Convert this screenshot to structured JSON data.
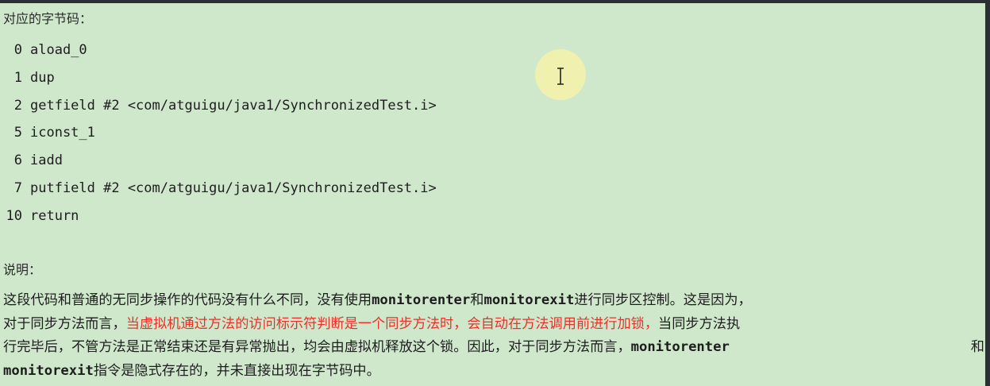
{
  "heading_bytecode": "对应的字节码：",
  "bytecode": [
    {
      "offset": "0",
      "instruction": "aload_0"
    },
    {
      "offset": "1",
      "instruction": "dup"
    },
    {
      "offset": "2",
      "instruction": "getfield #2 <com/atguigu/java1/SynchronizedTest.i>"
    },
    {
      "offset": "5",
      "instruction": "iconst_1"
    },
    {
      "offset": "6",
      "instruction": "iadd"
    },
    {
      "offset": "7",
      "instruction": "putfield #2 <com/atguigu/java1/SynchronizedTest.i>"
    },
    {
      "offset": "10",
      "instruction": "return"
    }
  ],
  "heading_explanation": "说明：",
  "explanation": {
    "l1_a": "这段代码和普通的无同步操作的代码没有什么不同，没有使用",
    "l1_b": "monitorenter",
    "l1_c": "和",
    "l1_d": "monitorexit",
    "l1_e": "进行同步区控制。这是因为，",
    "l2_a": "对于同步方法而言，",
    "l2_red": "当虚拟机通过方法的访问标示符判断是一个同步方法时，会自动在方法调用前进行加锁，",
    "l2_c": "当同步方法执",
    "l3_a": "行完毕后，不管方法是正常结束还是有异常抛出，均会由虚拟机释放这个锁。因此，对于同步方法而言，",
    "l3_b": "monitorenter",
    "l3_c": "和",
    "l4_a": "monitorexit",
    "l4_b": "指令是隐式存在的，并未直接出现在字节码中。"
  },
  "cursor_icon": "text-cursor-icon",
  "colors": {
    "background": "#cfe8cc",
    "highlight_red": "#e8322a",
    "cursor_halo": "#f6f2a8"
  }
}
